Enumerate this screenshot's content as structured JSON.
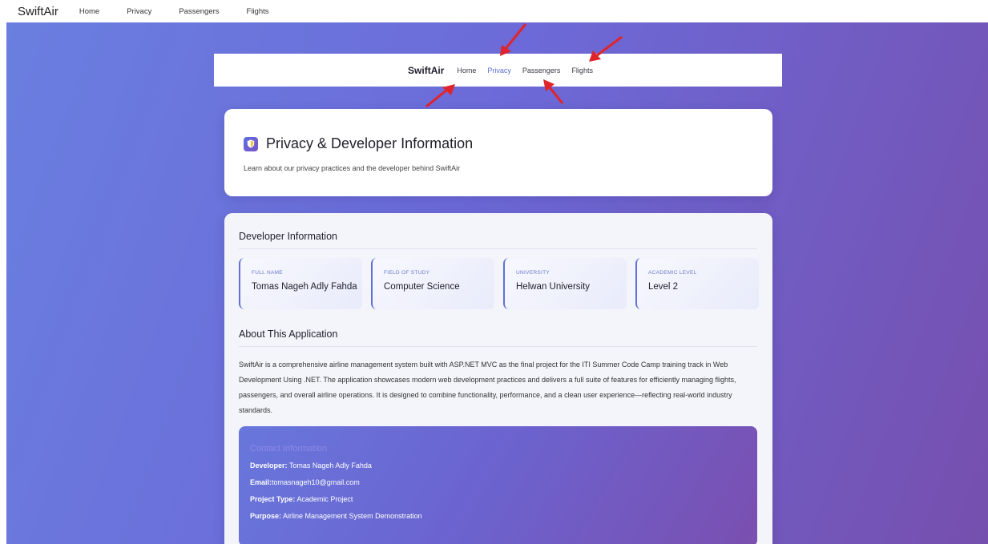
{
  "topbar": {
    "brand": "SwiftAir",
    "links": [
      "Home",
      "Privacy",
      "Passengers",
      "Flights"
    ]
  },
  "inner_nav": {
    "brand": "SwiftAir",
    "links": [
      "Home",
      "Privacy",
      "Passengers",
      "Flights"
    ],
    "active": "Privacy"
  },
  "header": {
    "title": "Privacy & Developer Information",
    "subtitle": "Learn about our privacy practices and the developer behind SwiftAir"
  },
  "developer": {
    "section_title": "Developer Information",
    "fields": [
      {
        "label": "FULL NAME",
        "value": "Tomas Nageh Adly Fahda"
      },
      {
        "label": "FIELD OF STUDY",
        "value": "Computer Science"
      },
      {
        "label": "UNIVERSITY",
        "value": "Helwan University"
      },
      {
        "label": "ACADEMIC LEVEL",
        "value": "Level 2"
      }
    ]
  },
  "about": {
    "section_title": "About This Application",
    "text": "SwiftAir is a comprehensive airline management system built with ASP.NET MVC as the final project for the ITI Summer Code Camp training track in Web Development Using .NET. The application showcases modern web development practices and delivers a full suite of features for efficiently managing flights, passengers, and overall airline operations. It is designed to combine functionality, performance, and a clean user experience—reflecting real-world industry standards."
  },
  "contact": {
    "title": "Contact Information",
    "developer_label": "Developer:",
    "developer_value": " Tomas Nageh Adly Fahda",
    "email_label": "Email:",
    "email_value": "tomasnageh10@gmail.com",
    "project_type_label": "Project Type:",
    "project_type_value": " Academic Project",
    "purpose_label": "Purpose:",
    "purpose_value": " Airline Management System Demonstration"
  },
  "colors": {
    "accent": "#5b6fd0",
    "gradient_start": "#6a7fe0",
    "gradient_end": "#764fae",
    "arrow": "#e0242b"
  },
  "icons": [
    "shield-icon",
    "arrow-annotation"
  ]
}
